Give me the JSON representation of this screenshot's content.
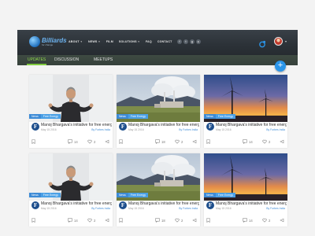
{
  "header": {
    "logo_name": "Billiards",
    "logo_tagline": "for change",
    "nav": [
      {
        "label": "ABOUT",
        "dropdown": true
      },
      {
        "label": "NEWS",
        "dropdown": true
      },
      {
        "label": "FILM",
        "dropdown": false
      },
      {
        "label": "SOLUTIONS",
        "dropdown": true
      },
      {
        "label": "FAQ",
        "dropdown": false
      },
      {
        "label": "CONTACT",
        "dropdown": false
      }
    ],
    "socials": [
      {
        "icon": "facebook-icon",
        "glyph": "f"
      },
      {
        "icon": "twitter-icon",
        "glyph": "t"
      },
      {
        "icon": "googleplus-icon",
        "glyph": "g"
      },
      {
        "icon": "youtube-icon",
        "glyph": "▸"
      }
    ]
  },
  "tabs": [
    {
      "label": "UPDATES",
      "active": true
    },
    {
      "label": "DISCUSSION",
      "active": false
    },
    {
      "label": "MEETUPS",
      "active": false
    }
  ],
  "fab_label": "+",
  "colors": {
    "accent_green": "#7fcb3f",
    "accent_blue": "#2a95e9",
    "header_dark": "#2c3238"
  },
  "cards": [
    {
      "image": "presenter",
      "badge_news": "News",
      "badge_cat": "Free Energy",
      "title": "Manoj Bhargava's initiative for free energy",
      "date": "May 15 2016",
      "author": "By Forbes India",
      "comments": "14",
      "likes": "2",
      "author_initial": "F"
    },
    {
      "image": "factory",
      "badge_news": "News",
      "badge_cat": "Free Energy",
      "title": "Manoj Bhargava's initiative for free energy",
      "date": "May 15 2016",
      "author": "By Forbes India",
      "comments": "18",
      "likes": "2",
      "author_initial": "F"
    },
    {
      "image": "windmill",
      "badge_news": "News",
      "badge_cat": "Free Energy",
      "title": "Manoj Bhargava's initiative for free energy",
      "date": "May 15 2016",
      "author": "By Forbes India",
      "comments": "14",
      "likes": "2",
      "author_initial": "F"
    },
    {
      "image": "presenter",
      "badge_news": "News",
      "badge_cat": "Free Energy",
      "title": "Manoj Bhargava's initiative for free energy",
      "date": "May 15 2016",
      "author": "By Forbes India",
      "comments": "14",
      "likes": "2",
      "author_initial": "F"
    },
    {
      "image": "factory",
      "badge_news": "News",
      "badge_cat": "Free Energy",
      "title": "Manoj Bhargava's initiative for free energy",
      "date": "May 15 2016",
      "author": "By Forbes India",
      "comments": "18",
      "likes": "2",
      "author_initial": "F"
    },
    {
      "image": "windmill",
      "badge_news": "News",
      "badge_cat": "Free Energy",
      "title": "Manoj Bhargava's initiative for free energy",
      "date": "May 15 2016",
      "author": "By Forbes India",
      "comments": "14",
      "likes": "2",
      "author_initial": "F"
    }
  ]
}
